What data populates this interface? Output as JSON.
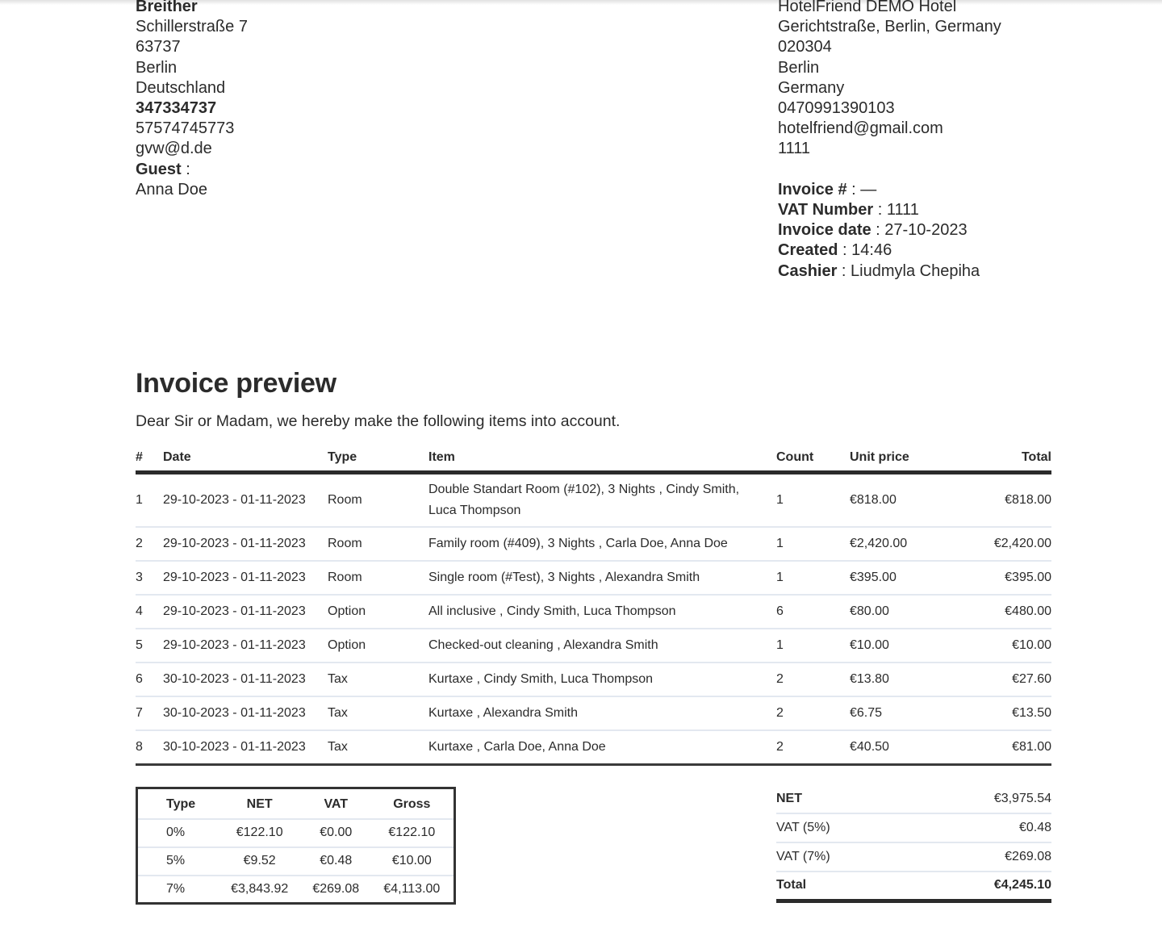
{
  "customer": {
    "name": "Breither",
    "street": "Schillerstraße 7",
    "zip": "63737",
    "city": "Berlin",
    "country": "Deutschland",
    "id": "347334737",
    "phone": "57574745773",
    "email": "gvw@d.de",
    "guest_label": "Guest",
    "guest_sep": " :",
    "guest_name": "Anna Doe"
  },
  "hotel": {
    "name": "HotelFriend DEMO Hotel",
    "address": "Gerichtstraße, Berlin, Germany",
    "zip": "020304",
    "city": "Berlin",
    "country": "Germany",
    "phone": "0470991390103",
    "email": "hotelfriend@gmail.com",
    "code": "1111"
  },
  "meta": {
    "invoice_no": {
      "label": "Invoice #",
      "value": " : —"
    },
    "vat_number": {
      "label": "VAT Number",
      "value": " : 1111"
    },
    "invoice_date": {
      "label": "Invoice date",
      "value": " : 27-10-2023"
    },
    "created": {
      "label": "Created",
      "value": " : 14:46"
    },
    "cashier": {
      "label": "Cashier",
      "value": " : Liudmyla Chepiha"
    }
  },
  "title": "Invoice preview",
  "intro": "Dear Sir or Madam, we hereby make the following items into account.",
  "items_table": {
    "headers": {
      "num": "#",
      "date": "Date",
      "type": "Type",
      "item": "Item",
      "count": "Count",
      "unit": "Unit price",
      "total": "Total"
    },
    "rows": [
      {
        "num": "1",
        "date": "29-10-2023 - 01-11-2023",
        "type": "Room",
        "item": "Double Standart Room (#102), 3 Nights , Cindy Smith, Luca Thompson",
        "count": "1",
        "unit": "€818.00",
        "total": "€818.00"
      },
      {
        "num": "2",
        "date": "29-10-2023 - 01-11-2023",
        "type": "Room",
        "item": "Family room (#409), 3 Nights , Carla Doe, Anna Doe",
        "count": "1",
        "unit": "€2,420.00",
        "total": "€2,420.00"
      },
      {
        "num": "3",
        "date": "29-10-2023 - 01-11-2023",
        "type": "Room",
        "item": "Single room (#Test), 3 Nights , Alexandra Smith",
        "count": "1",
        "unit": "€395.00",
        "total": "€395.00"
      },
      {
        "num": "4",
        "date": "29-10-2023 - 01-11-2023",
        "type": "Option",
        "item": "All inclusive , Cindy Smith, Luca Thompson",
        "count": "6",
        "unit": "€80.00",
        "total": "€480.00"
      },
      {
        "num": "5",
        "date": "29-10-2023 - 01-11-2023",
        "type": "Option",
        "item": "Checked-out cleaning , Alexandra Smith",
        "count": "1",
        "unit": "€10.00",
        "total": "€10.00"
      },
      {
        "num": "6",
        "date": "30-10-2023 - 01-11-2023",
        "type": "Tax",
        "item": "Kurtaxe , Cindy Smith, Luca Thompson",
        "count": "2",
        "unit": "€13.80",
        "total": "€27.60"
      },
      {
        "num": "7",
        "date": "30-10-2023 - 01-11-2023",
        "type": "Tax",
        "item": "Kurtaxe , Alexandra Smith",
        "count": "2",
        "unit": "€6.75",
        "total": "€13.50"
      },
      {
        "num": "8",
        "date": "30-10-2023 - 01-11-2023",
        "type": "Tax",
        "item": "Kurtaxe , Carla Doe, Anna Doe",
        "count": "2",
        "unit": "€40.50",
        "total": "€81.00"
      }
    ]
  },
  "vat_table": {
    "headers": {
      "type": "Type",
      "net": "NET",
      "vat": "VAT",
      "gross": "Gross"
    },
    "rows": [
      {
        "type": "0%",
        "net": "€122.10",
        "vat": "€0.00",
        "gross": "€122.10"
      },
      {
        "type": "5%",
        "net": "€9.52",
        "vat": "€0.48",
        "gross": "€10.00"
      },
      {
        "type": "7%",
        "net": "€3,843.92",
        "vat": "€269.08",
        "gross": "€4,113.00"
      }
    ]
  },
  "summary": [
    {
      "label": "NET",
      "value": "€3,975.54"
    },
    {
      "label": "VAT (5%)",
      "value": "€0.48"
    },
    {
      "label": "VAT (7%)",
      "value": "€269.08"
    },
    {
      "label": "Total",
      "value": "€4,245.10"
    }
  ]
}
